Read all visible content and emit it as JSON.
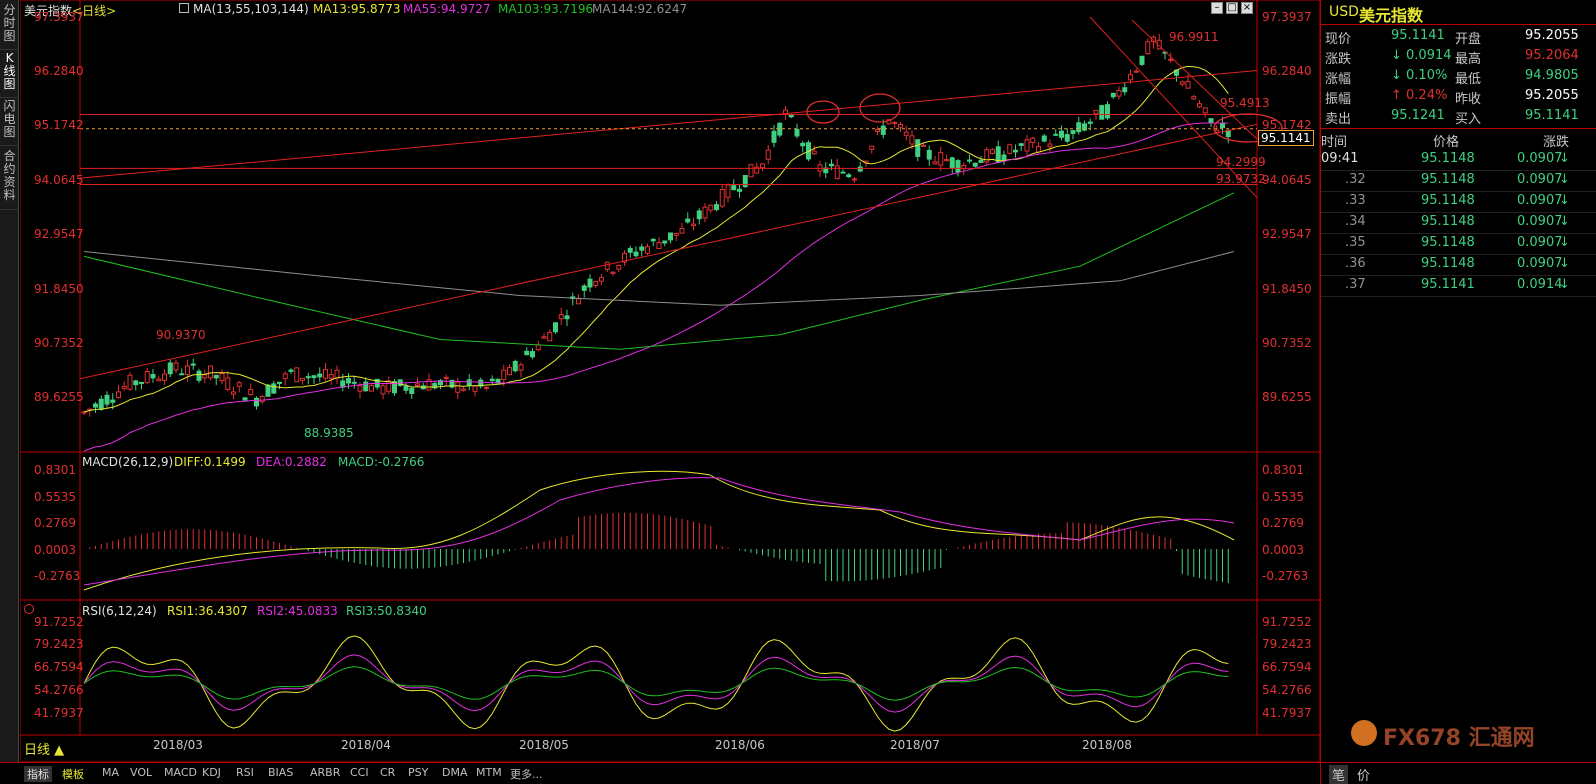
{
  "left_tabs": [
    "分时图",
    "K线图",
    "闪电图",
    "合约资料"
  ],
  "header": {
    "title": "美元指数",
    "period": "<日线>",
    "ma_label": "MA(13,55,103,144)",
    "ma13": "MA13:95.8773",
    "ma55": "MA55:94.9727",
    "ma103": "MA103:93.7196",
    "ma144": "MA144:92.6247"
  },
  "colors": {
    "ma13": "#e8e830",
    "ma55": "#e030e0",
    "ma103": "#20c020",
    "ma144": "#909090",
    "up": "#e03030",
    "down": "#40d080",
    "trend": "#e02020",
    "panel_text": "#e03030"
  },
  "price_axis": [
    "97.3937",
    "96.2840",
    "95.1742",
    "94.0645",
    "92.9547",
    "91.8450",
    "90.7352",
    "89.6255"
  ],
  "price_labels": {
    "high": "96.9911",
    "r1": "95.4913",
    "s1": "94.2999",
    "s2": "93.9732",
    "current": "95.1141",
    "old_high": "90.9370",
    "low": "88.9385"
  },
  "macd": {
    "label": "MACD(26,12,9)",
    "diff": "DIFF:0.1499",
    "dea": "DEA:0.2882",
    "macd": "MACD:-0.2766",
    "axis": [
      "0.8301",
      "0.5535",
      "0.2769",
      "0.0003",
      "-0.2763"
    ]
  },
  "rsi": {
    "label": "RSI(6,12,24)",
    "rsi1": "RSI1:36.4307",
    "rsi2": "RSI2:45.0833",
    "rsi3": "RSI3:50.8340",
    "axis": [
      "91.7252",
      "79.2423",
      "66.7594",
      "54.2766",
      "41.7937"
    ]
  },
  "dates": [
    "2018/03",
    "2018/04",
    "2018/05",
    "2018/06",
    "2018/07",
    "2018/08"
  ],
  "bottom_tabs": [
    "指标",
    "模板",
    "MA",
    "VOL",
    "MACD",
    "KDJ",
    "RSI",
    "BIAS",
    "ARBR",
    "CCI",
    "CR",
    "PSY",
    "DMA",
    "MTM",
    "更多..."
  ],
  "period_button": "日线 ▲",
  "quote": {
    "symbol": "USD",
    "name": "美元指数",
    "rows": [
      {
        "l1": "现价",
        "v1": "95.1141",
        "l2": "开盘",
        "v2": "95.2055"
      },
      {
        "l1": "涨跌",
        "v1": "↓ 0.0914",
        "l2": "最高",
        "v2": "95.2064"
      },
      {
        "l1": "涨幅",
        "v1": "↓ 0.10%",
        "l2": "最低",
        "v2": "94.9805"
      },
      {
        "l1": "振幅",
        "v1": "↑ 0.24%",
        "l2": "昨收",
        "v2": "95.2055"
      },
      {
        "l1": "卖出",
        "v1": "95.1241",
        "l2": "买入",
        "v2": "95.1141"
      }
    ]
  },
  "ticks": {
    "headers": [
      "时间",
      "价格",
      "涨跌"
    ],
    "rows": [
      {
        "t": "09:41",
        "p": "95.1148",
        "c": "0.0907"
      },
      {
        "t": ".32",
        "p": "95.1148",
        "c": "0.0907"
      },
      {
        "t": ".33",
        "p": "95.1148",
        "c": "0.0907"
      },
      {
        "t": ".34",
        "p": "95.1148",
        "c": "0.0907"
      },
      {
        "t": ".35",
        "p": "95.1148",
        "c": "0.0907"
      },
      {
        "t": ".36",
        "p": "95.1148",
        "c": "0.0907"
      },
      {
        "t": ".37",
        "p": "95.1141",
        "c": "0.0914"
      }
    ]
  },
  "right_bottom_tabs": [
    "笔",
    "价"
  ],
  "watermark": "FX678 汇通网"
}
